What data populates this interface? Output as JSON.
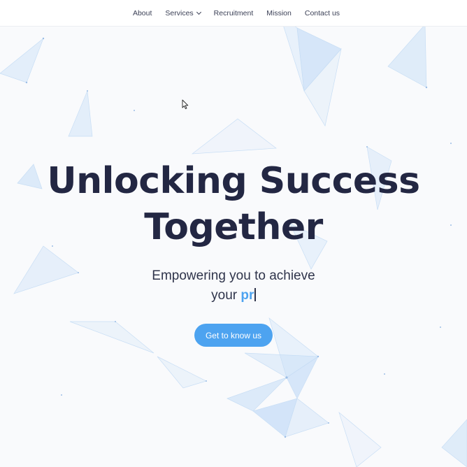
{
  "nav": {
    "items": [
      {
        "label": "About"
      },
      {
        "label": "Services"
      },
      {
        "label": "Recruitment"
      },
      {
        "label": "Mission"
      },
      {
        "label": "Contact us"
      }
    ]
  },
  "hero": {
    "title_line1": "Unlocking Success",
    "title_line2": "Together",
    "subtitle_line1": "Empowering you to achieve",
    "subtitle_line2_prefix": "your ",
    "subtitle_typed": "pr",
    "cta_label": "Get to know us"
  },
  "icons": [
    "chevron-down-icon",
    "mouse-pointer-icon"
  ],
  "colors": {
    "accent": "#4da3f0",
    "heading": "#232743",
    "background": "#f9fafc"
  }
}
